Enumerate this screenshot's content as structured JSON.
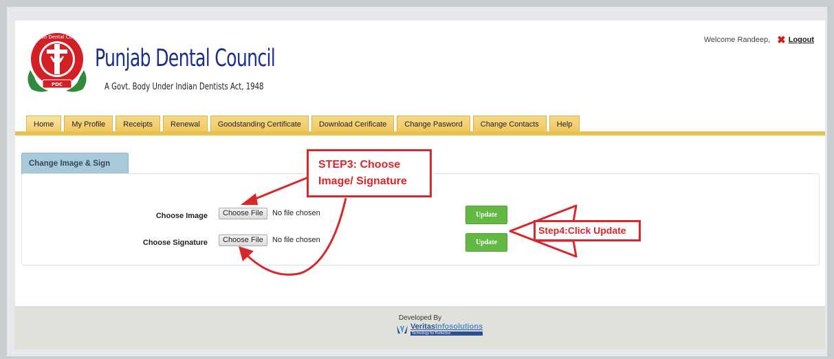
{
  "header": {
    "title": "Punjab Dental Council",
    "subtitle": "A Govt. Body Under Indian Dentists Act, 1948",
    "seal_top_text": "Punjab Dental Council",
    "seal_center_text": "PDC",
    "welcome_text": "Welcome Randeep,",
    "logout_label": "Logout"
  },
  "nav": {
    "tabs": [
      {
        "label": "Home"
      },
      {
        "label": "My Profile"
      },
      {
        "label": "Receipts"
      },
      {
        "label": "Renewal"
      },
      {
        "label": "Goodstanding Certificate"
      },
      {
        "label": "Download Cerificate"
      },
      {
        "label": "Change Pasword"
      },
      {
        "label": "Change Contacts"
      },
      {
        "label": "Help"
      }
    ],
    "active": "Home"
  },
  "section": {
    "title": "Change Image & Sign",
    "rows": [
      {
        "label": "Choose Image",
        "button": "Choose File",
        "status": "No file chosen",
        "update": "Update"
      },
      {
        "label": "Choose Signature",
        "button": "Choose File",
        "status": "No file chosen",
        "update": "Update"
      }
    ]
  },
  "annotations": {
    "step3_line1": "STEP3: Choose",
    "step3_line2": "Image/ Signature",
    "step4": "Step4:Click Update"
  },
  "footer": {
    "developed_by": "Developed By",
    "company_part1": "Veritas",
    "company_part2": "Infosolutions",
    "tagline": "Technology for Perfection"
  },
  "colors": {
    "brand": "#1b2f8a",
    "nav_tab": "#f0c860",
    "nav_bar": "#e8c24f",
    "update_button": "#64b944",
    "annotation": "#d8262b",
    "section_tab": "#a8c9d8"
  },
  "icons": {
    "logout": "close-x-icon",
    "seal": "dental-council-seal-logo",
    "company": "veritas-logo-icon"
  }
}
